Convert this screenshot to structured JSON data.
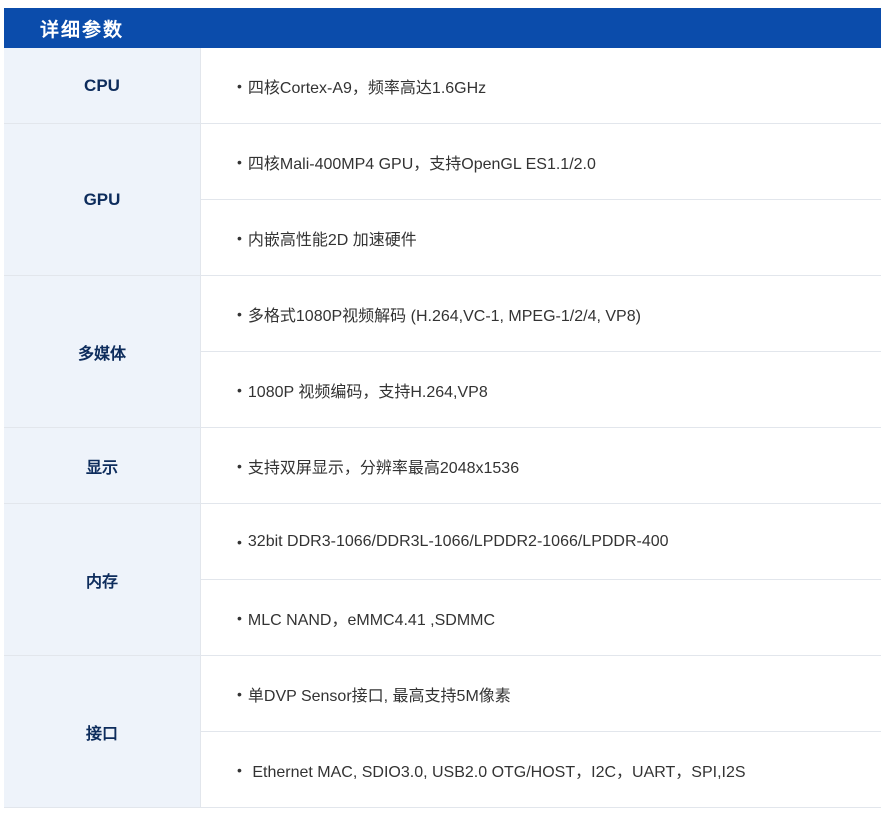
{
  "header": {
    "title": "详细参数"
  },
  "bullet_char": "•",
  "specs": [
    {
      "label": "CPU",
      "items": [
        "四核Cortex-A9，频率高达1.6GHz"
      ]
    },
    {
      "label": "GPU",
      "items": [
        "四核Mali-400MP4 GPU，支持OpenGL ES1.1/2.0",
        "内嵌高性能2D 加速硬件"
      ]
    },
    {
      "label": "多媒体",
      "items": [
        "多格式1080P视频解码 (H.264,VC-1, MPEG-1/2/4, VP8)",
        "1080P 视频编码，支持H.264,VP8"
      ]
    },
    {
      "label": "显示",
      "items": [
        "支持双屏显示，分辨率最高2048x1536"
      ]
    },
    {
      "label": "内存",
      "items": [
        "32bit DDR3-1066/DDR3L-1066/LPDDR2-1066/LPDDR-400",
        "MLC NAND，eMMC4.41 ,SDMMC"
      ]
    },
    {
      "label": "接口",
      "items": [
        "单DVP Sensor接口, 最高支持5M像素",
        " Ethernet MAC, SDIO3.0, USB2.0 OTG/HOST，I2C，UART，SPI,I2S"
      ]
    }
  ],
  "colors": {
    "header_bg": "#0b4cab",
    "label_bg": "#eef3fa",
    "label_text": "#0d2c5c",
    "value_text": "#333333",
    "border": "#e2e6ec"
  }
}
